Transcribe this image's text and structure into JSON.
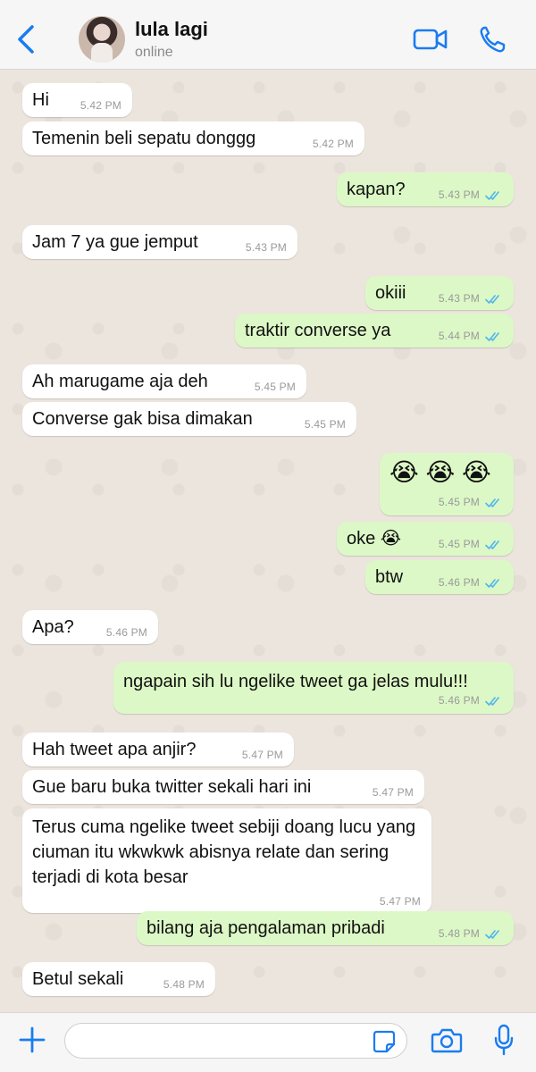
{
  "header": {
    "contact_name": "lula lagi",
    "status": "online",
    "icons": [
      "chevron-left-icon",
      "video-call-icon",
      "phone-icon"
    ]
  },
  "messages": [
    {
      "from": "in",
      "text": "Hi",
      "time": "5.42 PM"
    },
    {
      "from": "in",
      "text": "Temenin beli sepatu donggg",
      "time": "5.42 PM"
    },
    {
      "from": "out",
      "text": "kapan?",
      "time": "5.43 PM",
      "read": true
    },
    {
      "from": "in",
      "text": "Jam 7 ya gue jemput",
      "time": "5.43 PM"
    },
    {
      "from": "out",
      "text": "okiii",
      "time": "5.43 PM",
      "read": true
    },
    {
      "from": "out",
      "text": "traktir converse ya",
      "time": "5.44 PM",
      "read": true
    },
    {
      "from": "in",
      "text": "Ah marugame aja deh",
      "time": "5.45 PM"
    },
    {
      "from": "in",
      "text": "Converse gak bisa dimakan",
      "time": "5.45 PM"
    },
    {
      "from": "out",
      "text": "😭 😭 😭",
      "time": "5.45 PM",
      "read": true
    },
    {
      "from": "out",
      "text": "oke 😭",
      "time": "5.45 PM",
      "read": true
    },
    {
      "from": "out",
      "text": "btw",
      "time": "5.46 PM",
      "read": true
    },
    {
      "from": "in",
      "text": "Apa?",
      "time": "5.46 PM"
    },
    {
      "from": "out",
      "text": "ngapain sih lu ngelike tweet ga jelas mulu!!!",
      "time": "5.46 PM",
      "read": true
    },
    {
      "from": "in",
      "text": "Hah tweet apa anjir?",
      "time": "5.47 PM"
    },
    {
      "from": "in",
      "text": "Gue baru buka twitter sekali hari ini",
      "time": "5.47 PM"
    },
    {
      "from": "in",
      "text": "Terus cuma ngelike tweet sebiji doang lucu yang ciuman itu wkwkwk abisnya relate dan sering terjadi di kota besar",
      "time": "5.47 PM"
    },
    {
      "from": "out",
      "text": "bilang aja pengalaman pribadi",
      "time": "5.48 PM",
      "read": true
    },
    {
      "from": "in",
      "text": "Betul sekali",
      "time": "5.48 PM"
    }
  ],
  "composer": {
    "value": "",
    "icons": [
      "plus-icon",
      "sticker-icon",
      "camera-icon",
      "microphone-icon"
    ]
  },
  "colors": {
    "accent": "#1a7cf0",
    "incoming_bubble": "#ffffff",
    "outgoing_bubble": "#dcf8c6",
    "read_ticks": "#4fb6ec",
    "chat_background": "#ece5dd"
  }
}
